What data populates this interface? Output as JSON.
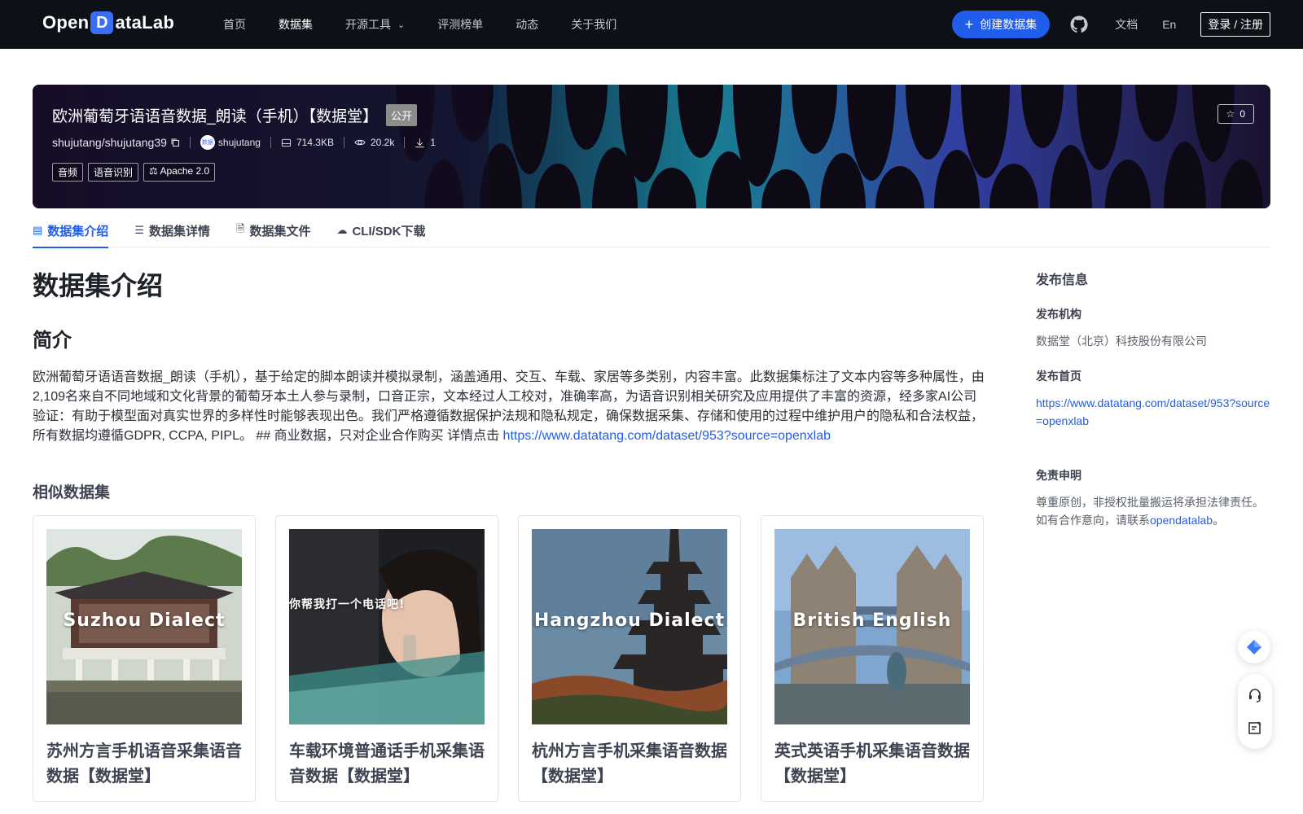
{
  "nav": {
    "logo": {
      "pre": "Open",
      "mark": "D",
      "post": "ataLab"
    },
    "links": [
      {
        "label": "首页",
        "active": false
      },
      {
        "label": "数据集",
        "active": true
      },
      {
        "label": "开源工具",
        "active": false,
        "dropdown": true
      },
      {
        "label": "评测榜单",
        "active": false
      },
      {
        "label": "动态",
        "active": false
      },
      {
        "label": "关于我们",
        "active": false
      }
    ],
    "create_label": "创建数据集",
    "docs_label": "文档",
    "lang_label": "En",
    "login_label": "登录 / 注册"
  },
  "hero": {
    "title": "欧洲葡萄牙语语音数据_朗读（手机）【数据堂】",
    "visibility": "公开",
    "repo": "shujutang/shujutang39",
    "avatar_text": "数据",
    "owner": "shujutang",
    "size": "714.3KB",
    "views": "20.2k",
    "downloads": "1",
    "tags": [
      "音频",
      "语音识别"
    ],
    "license": "Apache 2.0",
    "stars": "0"
  },
  "tabs": [
    {
      "label": "数据集介绍",
      "icon": "database-icon",
      "active": true
    },
    {
      "label": "数据集详情",
      "icon": "list-icon",
      "active": false
    },
    {
      "label": "数据集文件",
      "icon": "file-icon",
      "active": false
    },
    {
      "label": "CLI/SDK下载",
      "icon": "cloud-icon",
      "active": false
    }
  ],
  "main": {
    "heading": "数据集介绍",
    "subheading": "简介",
    "description": "欧洲葡萄牙语语音数据_朗读（手机），基于给定的脚本朗读并模拟录制，涵盖通用、交互、车载、家居等多类别，内容丰富。此数据集标注了文本内容等多种属性，由2,109名来自不同地域和文化背景的葡萄牙本土人参与录制，口音正宗，文本经过人工校对，准确率高，为语音识别相关研究及应用提供了丰富的资源，经多家AI公司验证：有助于模型面对真实世界的多样性时能够表现出色。我们严格遵循数据保护法规和隐私规定，确保数据采集、存储和使用的过程中维护用户的隐私和合法权益，所有数据均遵循GDPR, CCPA, PIPL。 ## 商业数据，只对企业合作购买 详情点击 ",
    "description_link": "https://www.datatang.com/dataset/953?source=openxlab",
    "similar_heading": "相似数据集",
    "cards": [
      {
        "image_label": "Suzhou Dialect",
        "title": "苏州方言手机语音采集语音数据【数据堂】"
      },
      {
        "image_label": "你帮我打一个电话吧!",
        "title": "车载环境普通话手机采集语音数据【数据堂】"
      },
      {
        "image_label": "Hangzhou Dialect",
        "title": "杭州方言手机采集语音数据【数据堂】"
      },
      {
        "image_label": "British English",
        "title": "英式英语手机采集语音数据【数据堂】"
      }
    ]
  },
  "sidebar": {
    "title": "发布信息",
    "org_label": "发布机构",
    "org_value": "数据堂（北京）科技股份有限公司",
    "home_label": "发布首页",
    "home_value": "https://www.datatang.com/dataset/953?source=openxlab",
    "disclaimer_label": "免责申明",
    "disclaimer_text": "尊重原创，非授权批量搬运将承担法律责任。如有合作意向，请联系",
    "disclaimer_link": "opendatalab",
    "disclaimer_end": "。"
  },
  "colors": {
    "accent": "#1f5dea",
    "nav_bg": "#0d1117"
  }
}
